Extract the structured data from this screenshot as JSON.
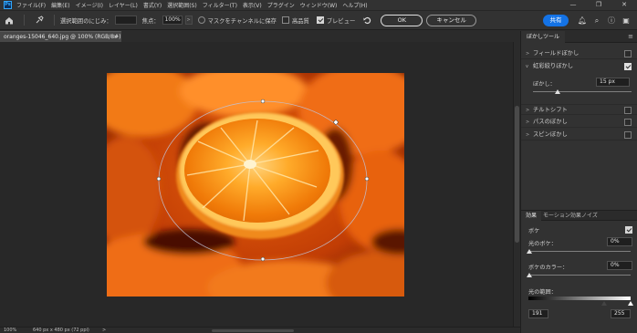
{
  "app": {
    "logo_text": "Ps"
  },
  "menu": [
    "ファイル(F)",
    "編集(E)",
    "イメージ(I)",
    "レイヤー(L)",
    "書式(Y)",
    "選択範囲(S)",
    "フィルター(T)",
    "表示(V)",
    "プラグイン",
    "ウィンドウ(W)",
    "ヘルプ(H)"
  ],
  "window_controls": {
    "minimize": "—",
    "maximize": "❐",
    "close": "✕"
  },
  "options": {
    "selection_fade_label": "選択範囲のにじみ：",
    "selection_fade_value": "",
    "focus_label": "焦点：",
    "focus_value": "100%",
    "save_mask_label": "マスクをチャンネルに保存",
    "high_quality_label": "高品質",
    "preview_label": "プレビュー",
    "ok_label": "OK",
    "cancel_label": "キャンセル",
    "share_label": "共有"
  },
  "document": {
    "tab_title": "oranges-15046_640.jpg @ 100% (RGB/8#)",
    "close_glyph": "×"
  },
  "status": {
    "zoom": "100%",
    "dimensions": "640 px x 480 px (72 ppi)",
    "arrow": ">"
  },
  "blur_panel": {
    "title": "ぼかしツール",
    "items": [
      {
        "label": "フィールドぼかし",
        "expanded": false,
        "checked": false
      },
      {
        "label": "虹彩絞りぼかし",
        "expanded": true,
        "checked": true
      },
      {
        "label": "チルトシフト",
        "expanded": false,
        "checked": false
      },
      {
        "label": "パスのぼかし",
        "expanded": false,
        "checked": false
      },
      {
        "label": "スピンぼかし",
        "expanded": false,
        "checked": false
      }
    ],
    "blur_label": "ぼかし：",
    "blur_value": "15 px",
    "blur_level": 0.25
  },
  "effects_panel": {
    "tabs": [
      "効果",
      "モーション効果",
      "ノイズ"
    ],
    "bokeh_label": "ボケ",
    "bokeh_checked": true,
    "light_bokeh_label": "光のボケ：",
    "light_bokeh_value": "0%",
    "bokeh_color_label": "ボケのカラー：",
    "bokeh_color_value": "0%",
    "light_range_label": "光の範囲：",
    "range_min": "191",
    "range_max": "255"
  },
  "colors": {
    "accent": "#1473e6",
    "panel_bg": "#323232",
    "workspace_bg": "#282828"
  }
}
